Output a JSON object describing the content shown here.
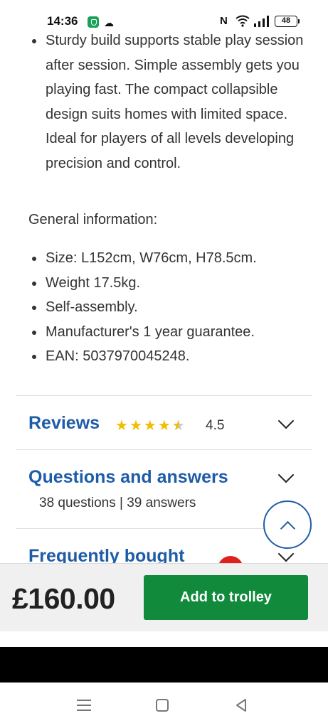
{
  "status_bar": {
    "time": "14:36",
    "battery": "48",
    "icons": [
      "shield-app-icon",
      "cloud-icon",
      "nfc-icon",
      "wifi-icon",
      "signal-icon",
      "battery-icon"
    ]
  },
  "description": {
    "bullets": [
      "Sturdy build supports stable play session after session. Simple assembly gets you playing fast. The compact collapsible design suits homes with limited space. Ideal for players of all levels developing precision and control."
    ]
  },
  "general_info": {
    "heading": "General information:",
    "items": [
      "Size: L152cm, W76cm, H78.5cm.",
      "Weight 17.5kg.",
      "Self-assembly.",
      "Manufacturer's 1 year guarantee.",
      "EAN: 5037970045248."
    ]
  },
  "reviews": {
    "title": "Reviews",
    "rating": "4.5",
    "rating_value": 4.5,
    "rating_max": 5
  },
  "qa": {
    "title": "Questions and answers",
    "counts": "38 questions | 39 answers"
  },
  "frequently_bought": {
    "title": "Frequently bought"
  },
  "buy_bar": {
    "price": "£160.00",
    "button_label": "Add to trolley"
  },
  "colors": {
    "accent_blue": "#1f5ca8",
    "button_green": "#118a3c",
    "star_yellow": "#f3bd00"
  }
}
